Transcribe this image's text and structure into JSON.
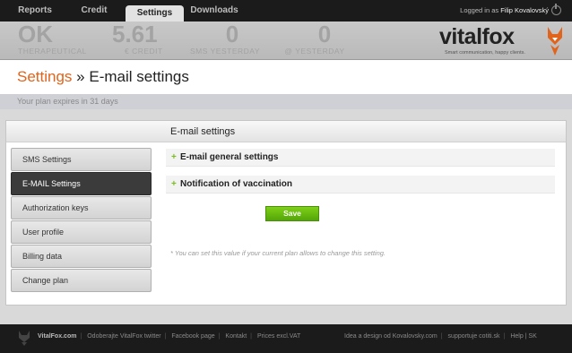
{
  "nav": {
    "tabs": [
      {
        "label": "Reports"
      },
      {
        "label": "Credit"
      },
      {
        "label": "Settings"
      },
      {
        "label": "Downloads"
      }
    ],
    "logged_in_prefix": "Logged in as",
    "user": "Filip Kovalovský"
  },
  "stats": [
    {
      "value": "OK",
      "label": "THERAPEUTICAL"
    },
    {
      "value": "5.61",
      "label": "€ CREDIT"
    },
    {
      "value": "0",
      "label": "SMS YESTERDAY"
    },
    {
      "value": "0",
      "label": "@ YESTERDAY"
    }
  ],
  "brand": {
    "name_a": "vital",
    "name_b": "fox",
    "tagline": "Smart communication, happy clients."
  },
  "page": {
    "breadcrumb": "Settings",
    "separator": "»",
    "title": "E-mail settings",
    "plan_notice": "Your plan expires in 31 days"
  },
  "panel": {
    "title": "E-mail settings",
    "menu": [
      {
        "label": "SMS Settings"
      },
      {
        "label": "E-MAIL Settings"
      },
      {
        "label": "Authorization keys"
      },
      {
        "label": "User profile"
      },
      {
        "label": "Billing data"
      },
      {
        "label": "Change plan"
      }
    ],
    "sections": [
      {
        "plus": "+",
        "label": "E-mail general settings"
      },
      {
        "plus": "+",
        "label": "Notification of vaccination"
      }
    ],
    "save_label": "Save",
    "note": "* You can set this value if your current plan allows to change this setting."
  },
  "footer": {
    "left": [
      "VitalFox.com",
      "Odoberajte VitalFox twitter",
      "Facebook page",
      "Kontakt",
      "Prices excl.VAT"
    ],
    "right": [
      "Idea a design od Kovalovsky.com",
      "supportuje cotiti.sk",
      "Help | SK"
    ]
  },
  "colors": {
    "accent": "#e0641b",
    "save": "#6cbd13",
    "nav": "#1b1b1b"
  }
}
